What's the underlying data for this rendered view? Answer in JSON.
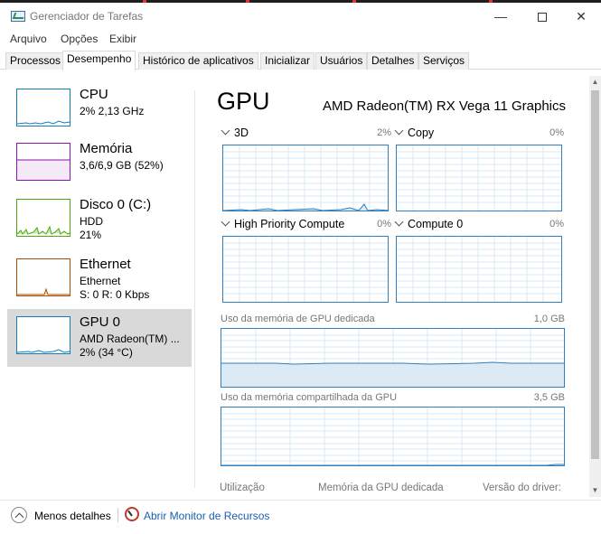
{
  "window": {
    "title": "Gerenciador de Tarefas"
  },
  "menu": [
    "Arquivo",
    "Opções",
    "Exibir"
  ],
  "tabs": [
    "Processos",
    "Desempenho",
    "Histórico de aplicativos",
    "Inicializar",
    "Usuários",
    "Detalhes",
    "Serviços"
  ],
  "active_tab": "Desempenho",
  "sidebar": {
    "items": [
      {
        "name": "CPU",
        "line1": "2% 2,13 GHz",
        "line2": "",
        "color": "#117dbb"
      },
      {
        "name": "Memória",
        "line1": "3,6/6,9 GB (52%)",
        "line2": "",
        "color": "#8b12ae"
      },
      {
        "name": "Disco 0 (C:)",
        "line1": "HDD",
        "line2": "21%",
        "color": "#4da60c"
      },
      {
        "name": "Ethernet",
        "line1": "Ethernet",
        "line2": "S: 0 R: 0 Kbps",
        "color": "#a74f01"
      },
      {
        "name": "GPU 0",
        "line1": "AMD Radeon(TM) ...",
        "line2": "2% (34 °C)",
        "color": "#117dbb",
        "selected": true
      }
    ]
  },
  "main": {
    "title": "GPU",
    "model": "AMD Radeon(TM) RX Vega 11 Graphics",
    "engines": [
      {
        "label": "3D",
        "percent": "2%"
      },
      {
        "label": "Copy",
        "percent": "0%"
      },
      {
        "label": "High Priority Compute",
        "percent": "0%"
      },
      {
        "label": "Compute 0",
        "percent": "0%"
      }
    ],
    "dedicated": {
      "label": "Uso da memória de GPU dedicada",
      "max": "1,0 GB"
    },
    "shared": {
      "label": "Uso da memória compartilhada da GPU",
      "max": "3,5 GB"
    },
    "stats": [
      "Utilização",
      "Memória da GPU dedicada",
      "Versão do driver:"
    ]
  },
  "footer": {
    "fewer_details": "Menos detalhes",
    "resource_monitor": "Abrir Monitor de Recursos"
  },
  "colors": {
    "graph_border": "#2f7fc1",
    "link": "#1a5fb4",
    "selected_bg": "#d9d9d9"
  }
}
